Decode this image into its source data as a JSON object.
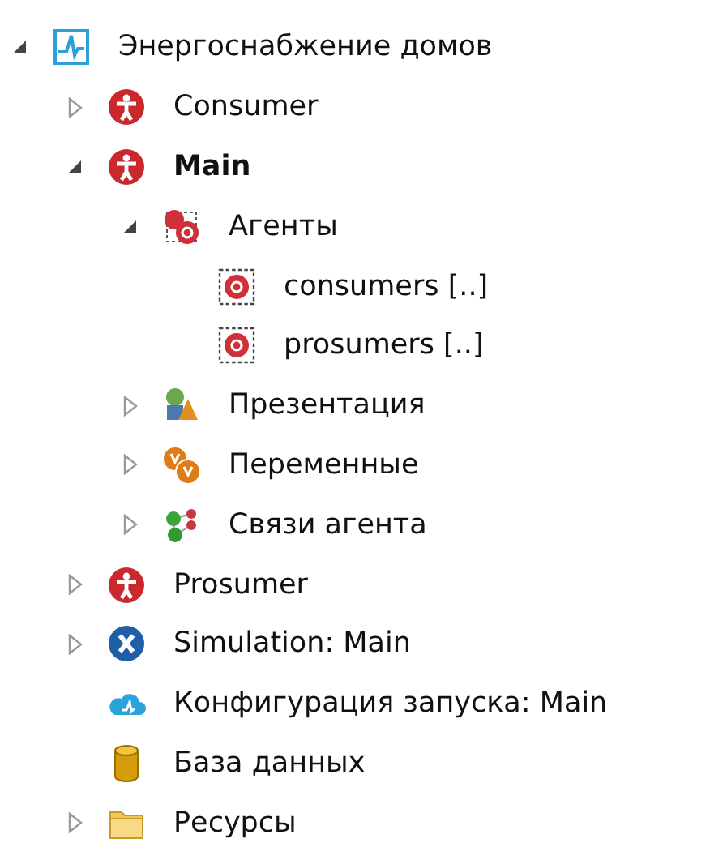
{
  "tree": [
    {
      "kind": "model",
      "label": "Энергоснабжение домов",
      "expanded": true,
      "bold": false,
      "children": [
        {
          "kind": "agent",
          "label": "Consumer",
          "expanded": false,
          "bold": false
        },
        {
          "kind": "agent",
          "label": "Main",
          "expanded": true,
          "bold": true,
          "children": [
            {
              "kind": "agent-group",
              "label": "Агенты",
              "expanded": true,
              "bold": false,
              "children": [
                {
                  "kind": "population",
                  "label": "consumers [..]",
                  "bold": false
                },
                {
                  "kind": "population",
                  "label": "prosumers [..]",
                  "bold": false
                }
              ]
            },
            {
              "kind": "presentation",
              "label": "Презентация",
              "expanded": false,
              "bold": false
            },
            {
              "kind": "variables",
              "label": "Переменные",
              "expanded": false,
              "bold": false
            },
            {
              "kind": "links",
              "label": "Связи агента",
              "expanded": false,
              "bold": false
            }
          ]
        },
        {
          "kind": "agent",
          "label": "Prosumer",
          "expanded": false,
          "bold": false
        },
        {
          "kind": "simulation",
          "label": "Simulation: Main",
          "expanded": false,
          "bold": false
        },
        {
          "kind": "run-config",
          "label": "Конфигурация запуска: Main",
          "bold": false
        },
        {
          "kind": "database",
          "label": "База данных",
          "bold": false
        },
        {
          "kind": "folder",
          "label": "Ресурсы",
          "expanded": false,
          "bold": false
        }
      ]
    }
  ]
}
